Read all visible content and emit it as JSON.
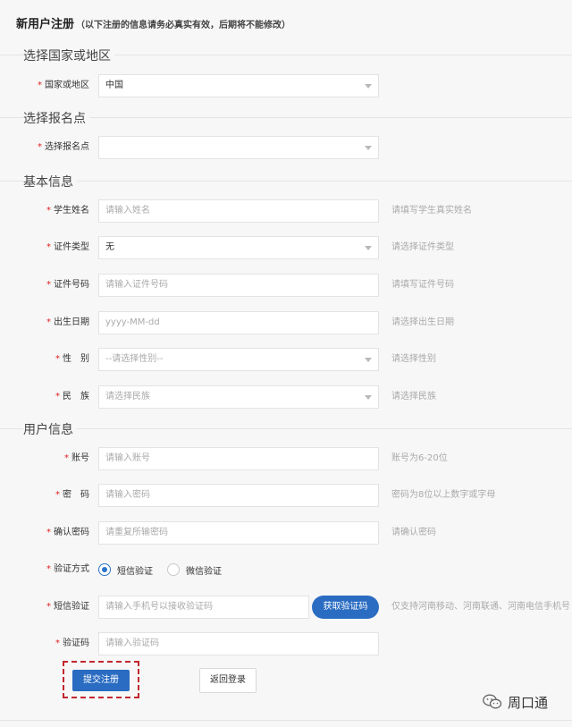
{
  "header": {
    "title": "新用户注册",
    "note": "（以下注册的信息请务必真实有效，后期将不能修改）"
  },
  "sections": {
    "country": "选择国家或地区",
    "site": "选择报名点",
    "basic": "基本信息",
    "user": "用户信息"
  },
  "required_mark": "*",
  "fields": {
    "country": {
      "label": "国家或地区",
      "value": "中国"
    },
    "site": {
      "label": "选择报名点",
      "value": ""
    },
    "name": {
      "label": "学生姓名",
      "placeholder": "请输入姓名",
      "hint": "请填写学生真实姓名"
    },
    "id_type": {
      "label": "证件类型",
      "value": "无",
      "hint": "请选择证件类型"
    },
    "id_number": {
      "label": "证件号码",
      "placeholder": "请输入证件号码",
      "hint": "请填写证件号码"
    },
    "birthdate": {
      "label": "出生日期",
      "placeholder": "yyyy-MM-dd",
      "hint": "请选择出生日期"
    },
    "gender": {
      "label": "性　别",
      "value": "--请选择性别--",
      "hint": "请选择性别"
    },
    "ethnicity": {
      "label": "民　族",
      "value": "请选择民族",
      "hint": "请选择民族"
    },
    "account": {
      "label": "账号",
      "placeholder": "请输入账号",
      "hint": "账号为6-20位"
    },
    "password": {
      "label": "密　码",
      "placeholder": "请输入密码",
      "hint": "密码为8位以上数字或字母"
    },
    "confirm": {
      "label": "确认密码",
      "placeholder": "请重复所输密码",
      "hint": "请确认密码"
    },
    "verify_method": {
      "label": "验证方式",
      "options": [
        "短信验证",
        "微信验证"
      ],
      "selected": "短信验证"
    },
    "sms": {
      "label": "短信验证",
      "placeholder": "请输入手机号以接收验证码",
      "button": "获取验证码",
      "hint": "仅支持河南移动、河南联通、河南电信手机号"
    },
    "code": {
      "label": "验证码",
      "placeholder": "请输入验证码"
    }
  },
  "buttons": {
    "submit": "提交注册",
    "back": "返回登录"
  },
  "watermark": "周口通",
  "colors": {
    "primary": "#2a6cc2",
    "required": "#e02020",
    "highlight_border": "#c4262e"
  }
}
